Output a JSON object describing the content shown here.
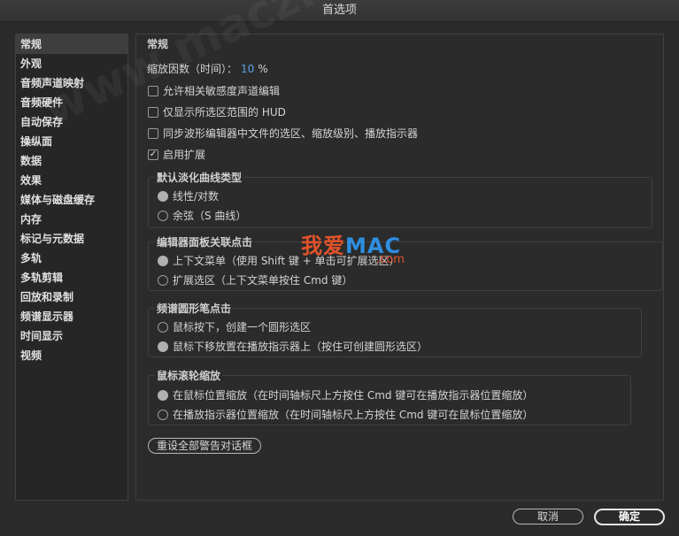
{
  "window": {
    "title": "首选项"
  },
  "sidebar": {
    "items": [
      {
        "label": "常规",
        "active": true
      },
      {
        "label": "外观"
      },
      {
        "label": "音频声道映射"
      },
      {
        "label": "音频硬件"
      },
      {
        "label": "自动保存"
      },
      {
        "label": "操纵面"
      },
      {
        "label": "数据"
      },
      {
        "label": "效果"
      },
      {
        "label": "媒体与磁盘缓存"
      },
      {
        "label": "内存"
      },
      {
        "label": "标记与元数据"
      },
      {
        "label": "多轨"
      },
      {
        "label": "多轨剪辑"
      },
      {
        "label": "回放和录制"
      },
      {
        "label": "频谱显示器"
      },
      {
        "label": "时间显示"
      },
      {
        "label": "视频"
      }
    ]
  },
  "general": {
    "title": "常规",
    "zoom_label": "缩放因数（时间）：",
    "zoom_value": "10",
    "zoom_unit": "%",
    "checkboxes": [
      {
        "label": "允许相关敏感度声道编辑",
        "checked": false
      },
      {
        "label": "仅显示所选区范围的 HUD",
        "checked": false
      },
      {
        "label": "同步波形编辑器中文件的选区、缩放级别、播放指示器",
        "checked": false
      },
      {
        "label": "启用扩展",
        "checked": true
      }
    ],
    "fade_group": {
      "title": "默认淡化曲线类型",
      "options": [
        {
          "label": "线性/对数",
          "selected": true
        },
        {
          "label": "余弦（S 曲线）",
          "selected": false
        }
      ]
    },
    "editor_click_group": {
      "title": "编辑器面板关联点击",
      "options": [
        {
          "label": "上下文菜单（使用 Shift 键 + 单击可扩展选区）",
          "selected": true
        },
        {
          "label": "扩展选区（上下文菜单按住 Cmd 键）",
          "selected": false
        }
      ]
    },
    "spectral_group": {
      "title": "频谱圆形笔点击",
      "options": [
        {
          "label": "鼠标按下，创建一个圆形选区",
          "selected": false
        },
        {
          "label": "鼠标下移放置在播放指示器上（按住可创建圆形选区）",
          "selected": true
        }
      ]
    },
    "wheel_group": {
      "title": "鼠标滚轮缩放",
      "options": [
        {
          "label": "在鼠标位置缩放（在时间轴标尺上方按住 Cmd 键可在播放指示器位置缩放）",
          "selected": true
        },
        {
          "label": "在播放指示器位置缩放（在时间轴标尺上方按住 Cmd 键可在鼠标位置缩放）",
          "selected": false
        }
      ]
    },
    "reset_warnings_label": "重设全部警告对话框"
  },
  "footer": {
    "cancel_label": "取消",
    "ok_label": "确定"
  },
  "watermark": {
    "brand_cn": "我爱",
    "brand_en": "MAC",
    "url": ".com",
    "diag": "www.macz.com"
  },
  "colors": {
    "accent": "#5aa0e6",
    "watermark_red": "#e0532b",
    "watermark_blue": "#2e8ee0"
  }
}
